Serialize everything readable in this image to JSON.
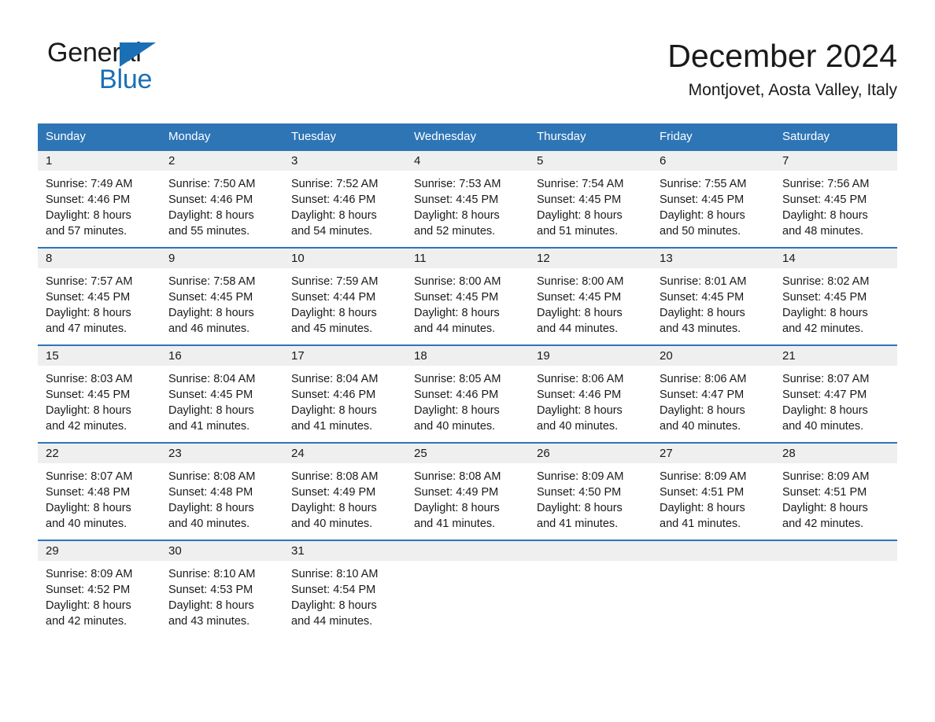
{
  "brand": {
    "name_dark": "General",
    "name_light": "Blue"
  },
  "header": {
    "title": "December 2024",
    "subtitle": "Montjovet, Aosta Valley, Italy"
  },
  "colors": {
    "header_blue": "#2e75b6",
    "brand_blue": "#1a6fb5",
    "daynum_band": "#efefef",
    "text": "#1a1a1a"
  },
  "weekdays": [
    "Sunday",
    "Monday",
    "Tuesday",
    "Wednesday",
    "Thursday",
    "Friday",
    "Saturday"
  ],
  "weeks": [
    [
      {
        "day": "1",
        "sunrise": "Sunrise: 7:49 AM",
        "sunset": "Sunset: 4:46 PM",
        "daylight_1": "Daylight: 8 hours",
        "daylight_2": "and 57 minutes."
      },
      {
        "day": "2",
        "sunrise": "Sunrise: 7:50 AM",
        "sunset": "Sunset: 4:46 PM",
        "daylight_1": "Daylight: 8 hours",
        "daylight_2": "and 55 minutes."
      },
      {
        "day": "3",
        "sunrise": "Sunrise: 7:52 AM",
        "sunset": "Sunset: 4:46 PM",
        "daylight_1": "Daylight: 8 hours",
        "daylight_2": "and 54 minutes."
      },
      {
        "day": "4",
        "sunrise": "Sunrise: 7:53 AM",
        "sunset": "Sunset: 4:45 PM",
        "daylight_1": "Daylight: 8 hours",
        "daylight_2": "and 52 minutes."
      },
      {
        "day": "5",
        "sunrise": "Sunrise: 7:54 AM",
        "sunset": "Sunset: 4:45 PM",
        "daylight_1": "Daylight: 8 hours",
        "daylight_2": "and 51 minutes."
      },
      {
        "day": "6",
        "sunrise": "Sunrise: 7:55 AM",
        "sunset": "Sunset: 4:45 PM",
        "daylight_1": "Daylight: 8 hours",
        "daylight_2": "and 50 minutes."
      },
      {
        "day": "7",
        "sunrise": "Sunrise: 7:56 AM",
        "sunset": "Sunset: 4:45 PM",
        "daylight_1": "Daylight: 8 hours",
        "daylight_2": "and 48 minutes."
      }
    ],
    [
      {
        "day": "8",
        "sunrise": "Sunrise: 7:57 AM",
        "sunset": "Sunset: 4:45 PM",
        "daylight_1": "Daylight: 8 hours",
        "daylight_2": "and 47 minutes."
      },
      {
        "day": "9",
        "sunrise": "Sunrise: 7:58 AM",
        "sunset": "Sunset: 4:45 PM",
        "daylight_1": "Daylight: 8 hours",
        "daylight_2": "and 46 minutes."
      },
      {
        "day": "10",
        "sunrise": "Sunrise: 7:59 AM",
        "sunset": "Sunset: 4:44 PM",
        "daylight_1": "Daylight: 8 hours",
        "daylight_2": "and 45 minutes."
      },
      {
        "day": "11",
        "sunrise": "Sunrise: 8:00 AM",
        "sunset": "Sunset: 4:45 PM",
        "daylight_1": "Daylight: 8 hours",
        "daylight_2": "and 44 minutes."
      },
      {
        "day": "12",
        "sunrise": "Sunrise: 8:00 AM",
        "sunset": "Sunset: 4:45 PM",
        "daylight_1": "Daylight: 8 hours",
        "daylight_2": "and 44 minutes."
      },
      {
        "day": "13",
        "sunrise": "Sunrise: 8:01 AM",
        "sunset": "Sunset: 4:45 PM",
        "daylight_1": "Daylight: 8 hours",
        "daylight_2": "and 43 minutes."
      },
      {
        "day": "14",
        "sunrise": "Sunrise: 8:02 AM",
        "sunset": "Sunset: 4:45 PM",
        "daylight_1": "Daylight: 8 hours",
        "daylight_2": "and 42 minutes."
      }
    ],
    [
      {
        "day": "15",
        "sunrise": "Sunrise: 8:03 AM",
        "sunset": "Sunset: 4:45 PM",
        "daylight_1": "Daylight: 8 hours",
        "daylight_2": "and 42 minutes."
      },
      {
        "day": "16",
        "sunrise": "Sunrise: 8:04 AM",
        "sunset": "Sunset: 4:45 PM",
        "daylight_1": "Daylight: 8 hours",
        "daylight_2": "and 41 minutes."
      },
      {
        "day": "17",
        "sunrise": "Sunrise: 8:04 AM",
        "sunset": "Sunset: 4:46 PM",
        "daylight_1": "Daylight: 8 hours",
        "daylight_2": "and 41 minutes."
      },
      {
        "day": "18",
        "sunrise": "Sunrise: 8:05 AM",
        "sunset": "Sunset: 4:46 PM",
        "daylight_1": "Daylight: 8 hours",
        "daylight_2": "and 40 minutes."
      },
      {
        "day": "19",
        "sunrise": "Sunrise: 8:06 AM",
        "sunset": "Sunset: 4:46 PM",
        "daylight_1": "Daylight: 8 hours",
        "daylight_2": "and 40 minutes."
      },
      {
        "day": "20",
        "sunrise": "Sunrise: 8:06 AM",
        "sunset": "Sunset: 4:47 PM",
        "daylight_1": "Daylight: 8 hours",
        "daylight_2": "and 40 minutes."
      },
      {
        "day": "21",
        "sunrise": "Sunrise: 8:07 AM",
        "sunset": "Sunset: 4:47 PM",
        "daylight_1": "Daylight: 8 hours",
        "daylight_2": "and 40 minutes."
      }
    ],
    [
      {
        "day": "22",
        "sunrise": "Sunrise: 8:07 AM",
        "sunset": "Sunset: 4:48 PM",
        "daylight_1": "Daylight: 8 hours",
        "daylight_2": "and 40 minutes."
      },
      {
        "day": "23",
        "sunrise": "Sunrise: 8:08 AM",
        "sunset": "Sunset: 4:48 PM",
        "daylight_1": "Daylight: 8 hours",
        "daylight_2": "and 40 minutes."
      },
      {
        "day": "24",
        "sunrise": "Sunrise: 8:08 AM",
        "sunset": "Sunset: 4:49 PM",
        "daylight_1": "Daylight: 8 hours",
        "daylight_2": "and 40 minutes."
      },
      {
        "day": "25",
        "sunrise": "Sunrise: 8:08 AM",
        "sunset": "Sunset: 4:49 PM",
        "daylight_1": "Daylight: 8 hours",
        "daylight_2": "and 41 minutes."
      },
      {
        "day": "26",
        "sunrise": "Sunrise: 8:09 AM",
        "sunset": "Sunset: 4:50 PM",
        "daylight_1": "Daylight: 8 hours",
        "daylight_2": "and 41 minutes."
      },
      {
        "day": "27",
        "sunrise": "Sunrise: 8:09 AM",
        "sunset": "Sunset: 4:51 PM",
        "daylight_1": "Daylight: 8 hours",
        "daylight_2": "and 41 minutes."
      },
      {
        "day": "28",
        "sunrise": "Sunrise: 8:09 AM",
        "sunset": "Sunset: 4:51 PM",
        "daylight_1": "Daylight: 8 hours",
        "daylight_2": "and 42 minutes."
      }
    ],
    [
      {
        "day": "29",
        "sunrise": "Sunrise: 8:09 AM",
        "sunset": "Sunset: 4:52 PM",
        "daylight_1": "Daylight: 8 hours",
        "daylight_2": "and 42 minutes."
      },
      {
        "day": "30",
        "sunrise": "Sunrise: 8:10 AM",
        "sunset": "Sunset: 4:53 PM",
        "daylight_1": "Daylight: 8 hours",
        "daylight_2": "and 43 minutes."
      },
      {
        "day": "31",
        "sunrise": "Sunrise: 8:10 AM",
        "sunset": "Sunset: 4:54 PM",
        "daylight_1": "Daylight: 8 hours",
        "daylight_2": "and 44 minutes."
      },
      {
        "day": "",
        "sunrise": "",
        "sunset": "",
        "daylight_1": "",
        "daylight_2": ""
      },
      {
        "day": "",
        "sunrise": "",
        "sunset": "",
        "daylight_1": "",
        "daylight_2": ""
      },
      {
        "day": "",
        "sunrise": "",
        "sunset": "",
        "daylight_1": "",
        "daylight_2": ""
      },
      {
        "day": "",
        "sunrise": "",
        "sunset": "",
        "daylight_1": "",
        "daylight_2": ""
      }
    ]
  ]
}
